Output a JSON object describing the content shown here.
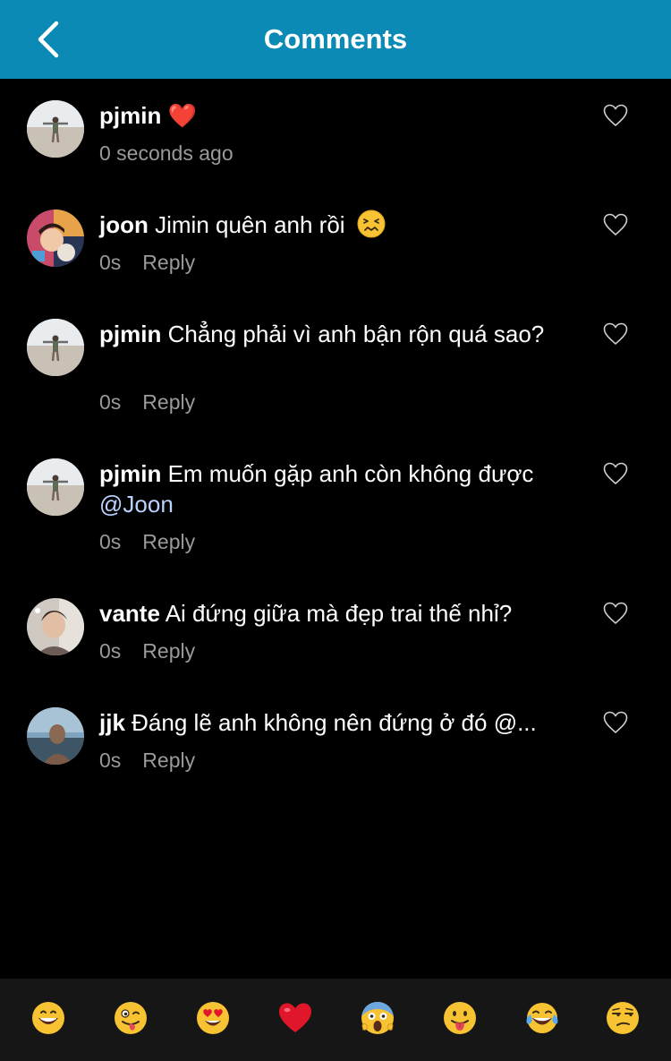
{
  "header": {
    "title": "Comments",
    "back_icon": "chevron-left-icon",
    "background": "#0a8ab4"
  },
  "comments": [
    {
      "username": "pjmin",
      "text": "",
      "emoji": "❤️",
      "time": "0 seconds ago",
      "reply": "",
      "avatar": "beach-person-arms-out-avatar"
    },
    {
      "username": "joon",
      "text": "Jimin quên anh rồi",
      "emoji": "😖",
      "time": "0s",
      "reply": "Reply",
      "avatar": "colorful-selfie-avatar"
    },
    {
      "username": "pjmin",
      "text": "Chẳng phải vì anh bận rộn quá sao?",
      "time": "0s",
      "reply": "Reply",
      "avatar": "beach-person-arms-out-avatar"
    },
    {
      "username": "pjmin",
      "text": "Em muốn gặp anh còn không được",
      "mention": "@Joon",
      "time": "0s",
      "reply": "Reply",
      "avatar": "beach-person-arms-out-avatar"
    },
    {
      "username": "vante",
      "text": "Ai đứng giữa mà đẹp trai thế nhỉ?",
      "time": "0s",
      "reply": "Reply",
      "avatar": "portrait-avatar"
    },
    {
      "username": "jjk",
      "text": "Đáng lẽ anh không nên đứng ở đó @...",
      "time": "0s",
      "reply": "Reply",
      "avatar": "seaside-silhouette-avatar"
    }
  ],
  "like_icon": "heart-outline-icon",
  "emoji_bar": [
    {
      "emoji": "😄",
      "icon": "grinning-face-icon"
    },
    {
      "emoji": "😜",
      "icon": "winking-tongue-face-icon"
    },
    {
      "emoji": "😍",
      "icon": "heart-eyes-face-icon"
    },
    {
      "emoji": "❤️",
      "icon": "red-heart-icon"
    },
    {
      "emoji": "😱",
      "icon": "screaming-face-icon"
    },
    {
      "emoji": "😛",
      "icon": "tongue-face-icon"
    },
    {
      "emoji": "😂",
      "icon": "tears-of-joy-face-icon"
    },
    {
      "emoji": "😒",
      "icon": "unamused-face-icon"
    }
  ]
}
